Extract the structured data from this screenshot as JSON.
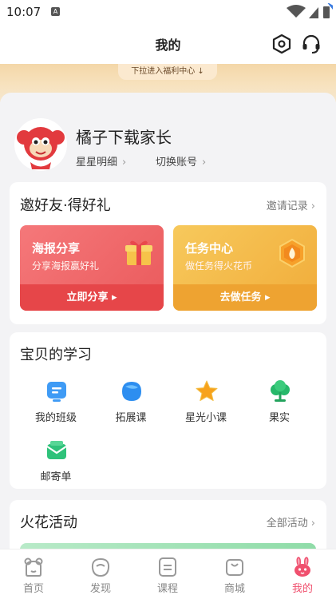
{
  "status_bar": {
    "time": "10:07",
    "badge": "A"
  },
  "header": {
    "title": "我的"
  },
  "banner": {
    "pull_text": "下拉进入福利中心 ↓"
  },
  "profile": {
    "name": "橘子下载家长",
    "links": [
      {
        "label": "星星明细"
      },
      {
        "label": "切换账号"
      }
    ]
  },
  "invite": {
    "title": "邀好友·得好礼",
    "more": "邀请记录",
    "cards": [
      {
        "title": "海报分享",
        "sub": "分享海报赢好礼",
        "button": "立即分享 ▸"
      },
      {
        "title": "任务中心",
        "sub": "做任务得火花币",
        "button": "去做任务 ▸"
      }
    ]
  },
  "study": {
    "title": "宝贝的学习",
    "items": [
      {
        "label": "我的班级",
        "icon": "class-icon"
      },
      {
        "label": "拓展课",
        "icon": "extension-course-icon"
      },
      {
        "label": "星光小课",
        "icon": "star-course-icon"
      },
      {
        "label": "果实",
        "icon": "fruit-tree-icon"
      },
      {
        "label": "邮寄单",
        "icon": "mail-order-icon"
      }
    ]
  },
  "activities": {
    "title": "火花活动",
    "more": "全部活动"
  },
  "tabs": [
    {
      "label": "首页",
      "icon": "home-bear-icon",
      "active": false
    },
    {
      "label": "发现",
      "icon": "discover-icon",
      "active": false
    },
    {
      "label": "课程",
      "icon": "course-icon",
      "active": false
    },
    {
      "label": "商城",
      "icon": "shop-icon",
      "active": false
    },
    {
      "label": "我的",
      "icon": "profile-bunny-icon",
      "active": true
    }
  ],
  "colors": {
    "accent": "#f0506e",
    "promo_red": "#ea5a5c",
    "promo_orange": "#f1ac3a"
  }
}
